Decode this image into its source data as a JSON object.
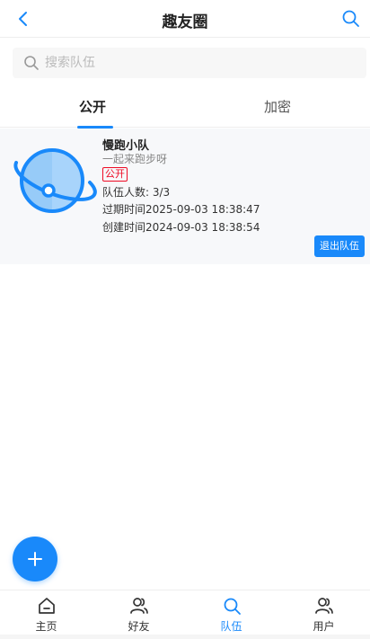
{
  "header": {
    "title": "趣友圈",
    "back_icon": "chevron-left-icon",
    "search_icon": "search-icon"
  },
  "search": {
    "placeholder": "搜索队伍",
    "value": ""
  },
  "tabs": [
    {
      "label": "公开",
      "active": true
    },
    {
      "label": "加密",
      "active": false
    }
  ],
  "team_card": {
    "name": "慢跑小队",
    "description": "一起来跑步呀",
    "tag": "公开",
    "members": "队伍人数: 3/3",
    "expire": "过期时间2025-09-03 18:38:47",
    "created": "创建时间2024-09-03 18:38:54",
    "quit_label": "退出队伍",
    "image_icon": "planet-icon"
  },
  "fab": {
    "icon": "plus-icon"
  },
  "tabbar": [
    {
      "label": "主页",
      "icon": "home-icon",
      "active": false
    },
    {
      "label": "好友",
      "icon": "users-icon",
      "active": false
    },
    {
      "label": "队伍",
      "icon": "search-icon",
      "active": true
    },
    {
      "label": "用户",
      "icon": "user-icon",
      "active": false
    }
  ],
  "colors": {
    "accent": "#1989fa",
    "tag_red": "#ee0a24",
    "card_bg": "#f7f8fa"
  }
}
